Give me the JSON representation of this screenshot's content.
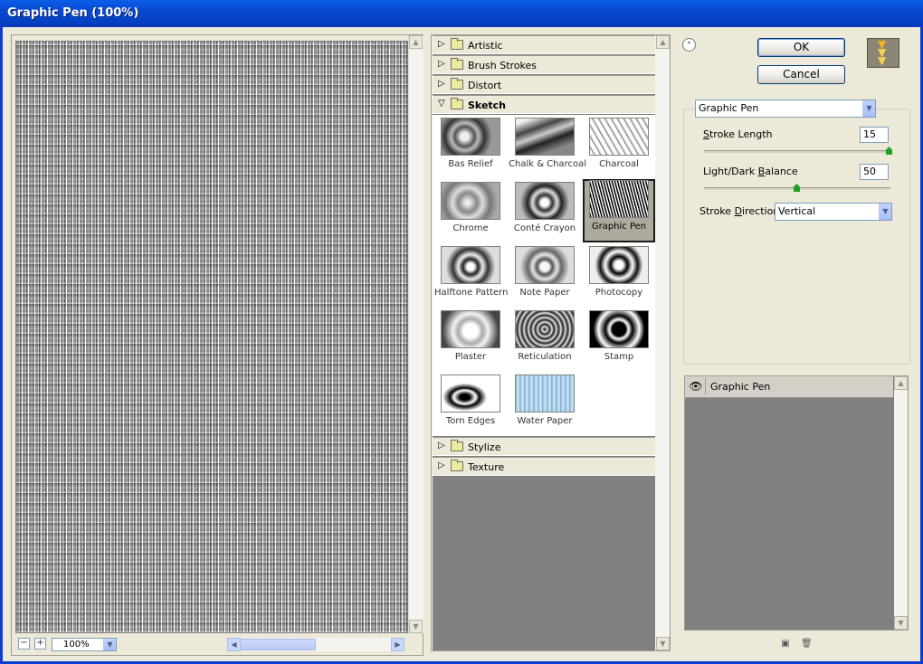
{
  "window": {
    "title": "Graphic Pen (100%)"
  },
  "preview": {
    "zoom": "100%",
    "zoom_out": "−",
    "zoom_in": "+"
  },
  "categories_top": [
    {
      "label": "Artistic"
    },
    {
      "label": "Brush Strokes"
    },
    {
      "label": "Distort"
    }
  ],
  "category_open": {
    "label": "Sketch"
  },
  "filters": [
    {
      "label": "Bas Relief"
    },
    {
      "label": "Chalk & Charcoal"
    },
    {
      "label": "Charcoal"
    },
    {
      "label": "Chrome"
    },
    {
      "label": "Conté Crayon"
    },
    {
      "label": "Graphic Pen",
      "selected": true
    },
    {
      "label": "Halftone Pattern"
    },
    {
      "label": "Note Paper"
    },
    {
      "label": "Photocopy"
    },
    {
      "label": "Plaster"
    },
    {
      "label": "Reticulation"
    },
    {
      "label": "Stamp"
    },
    {
      "label": "Torn Edges"
    },
    {
      "label": "Water Paper"
    }
  ],
  "categories_bottom": [
    {
      "label": "Stylize"
    },
    {
      "label": "Texture"
    }
  ],
  "buttons": {
    "ok": "OK",
    "cancel": "Cancel"
  },
  "settings": {
    "filter_select": "Graphic Pen",
    "stroke_length": {
      "label_pre": "",
      "label_u": "S",
      "label_post": "troke Length",
      "value": "15",
      "min": 0,
      "max": 15
    },
    "light_dark": {
      "label_pre": "Light/Dark ",
      "label_u": "B",
      "label_post": "alance",
      "value": "50",
      "min": 0,
      "max": 100
    },
    "direction": {
      "label_pre": "Stroke ",
      "label_u": "D",
      "label_post": "irection:",
      "value": "Vertical"
    }
  },
  "layers": [
    {
      "name": "Graphic Pen"
    }
  ],
  "icons": {
    "eye": "eye-icon",
    "new_layer": "new-layer-icon",
    "delete_layer": "trash-icon"
  }
}
